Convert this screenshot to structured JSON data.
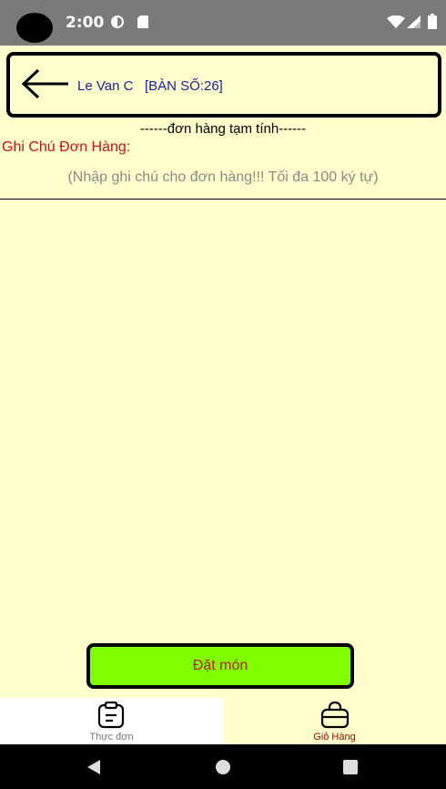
{
  "status_bar": {
    "time": "2:00"
  },
  "header": {
    "customer_name": "Le Van C",
    "table_label": "[BÀN SỐ:26]"
  },
  "order": {
    "title": "------đơn hàng tạm tính------",
    "note_label": "Ghi Chú Đơn Hàng:",
    "note_placeholder": "(Nhập ghi chú cho đơn hàng!!! Tối đa 100 ký tự)",
    "note_value": ""
  },
  "actions": {
    "order_button_label": "Đặt món"
  },
  "bottom_nav": {
    "items": [
      {
        "label": "Thực đơn",
        "icon": "clipboard-icon",
        "selected": false
      },
      {
        "label": "Giỏ Hàng",
        "icon": "shopping-bag-icon",
        "selected": true
      }
    ]
  },
  "colors": {
    "background": "#FFFFCC",
    "accent_button": "#7FFF00",
    "note_label": "#CC1111",
    "header_text": "#1A1AA8",
    "selected_tab": "#B00000"
  }
}
